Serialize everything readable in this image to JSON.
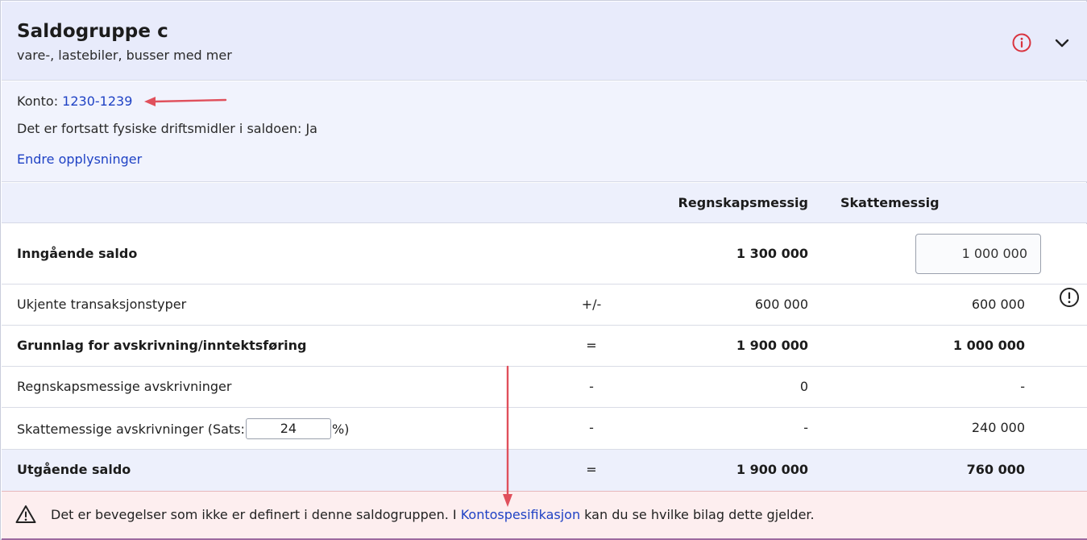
{
  "header": {
    "title": "Saldogruppe c",
    "subtitle": "vare-, lastebiler, busser med mer",
    "info_icon": "info-circle-icon",
    "expand_icon": "chevron-down-icon"
  },
  "details": {
    "konto_label": "Konto:",
    "konto_value": "1230-1239",
    "still_assets_text": "Det er fortsatt fysiske driftsmidler i saldoen: Ja",
    "edit_link": "Endre opplysninger"
  },
  "columns": {
    "regnskap": "Regnskapsmessig",
    "skatt": "Skattemessig"
  },
  "rows": {
    "inngaende": {
      "label": "Inngående saldo",
      "regnskap": "1 300 000",
      "skatt_input": "1 000 000"
    },
    "ukjente": {
      "label": "Ukjente transaksjonstyper",
      "op": "+/-",
      "regnskap": "600 000",
      "skatt": "600 000"
    },
    "grunnlag": {
      "label": "Grunnlag for avskrivning/inntektsføring",
      "op": "=",
      "regnskap": "1 900 000",
      "skatt": "1 000 000"
    },
    "regnskap_avskr": {
      "label": "Regnskapsmessige avskrivninger",
      "op": "-",
      "regnskap": "0",
      "skatt": "-"
    },
    "skatt_avskr": {
      "label_prefix": "Skattemessige avskrivninger (Sats:",
      "sats_value": "24",
      "label_suffix": "%)",
      "op": "-",
      "regnskap": "-",
      "skatt": "240 000"
    },
    "utgaende": {
      "label": "Utgående saldo",
      "op": "=",
      "regnskap": "1 900 000",
      "skatt": "760 000"
    }
  },
  "alert": {
    "text_before": "Det er bevegelser som ikke er definert i denne saldogruppen. I ",
    "link": "Kontospesifikasjon",
    "text_after": " kan du se hvilke bilag dette gjelder.",
    "icon": "warning-triangle-icon"
  },
  "colors": {
    "header_bg": "#e8ebfb",
    "link": "#1f42c5",
    "alert_bg": "#fdeeef",
    "annotation_arrow": "#e0505c",
    "info_icon": "#d9343f"
  }
}
